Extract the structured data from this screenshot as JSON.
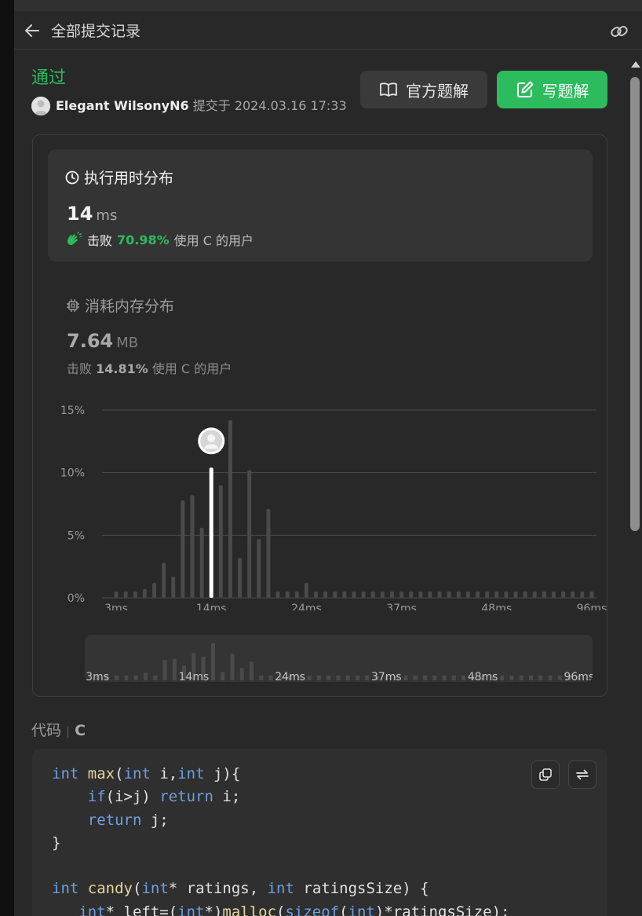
{
  "header": {
    "back_icon": "arrow-left-icon",
    "title": "全部提交记录",
    "link_icon": "link-icon"
  },
  "submission": {
    "status": "通过",
    "user": "Elegant WilsonyN6",
    "submitted_label": "提交于",
    "datetime": "2024.03.16 17:33"
  },
  "buttons": {
    "official_solution": "官方题解",
    "write_solution": "写题解"
  },
  "runtime": {
    "title": "执行用时分布",
    "value": "14",
    "unit": "ms",
    "beat_word": "击败",
    "beat_pct": "70.98%",
    "beat_suffix": "使用 C 的用户"
  },
  "memory": {
    "title": "消耗内存分布",
    "value": "7.64",
    "unit": "MB",
    "beat_word": "击败",
    "beat_pct": "14.81%",
    "beat_suffix": "使用 C 的用户"
  },
  "colors": {
    "accent": "#2cbb5d",
    "bar": "#4a4a4a",
    "highlight_bar": "#ffffff"
  },
  "chart_data": {
    "type": "bar",
    "ylabels": [
      "15%",
      "10%",
      "5%",
      "0%"
    ],
    "yticks": [
      15,
      10,
      5,
      0
    ],
    "ylim": [
      0,
      15
    ],
    "xticks": [
      "3ms",
      "14ms",
      "24ms",
      "37ms",
      "48ms",
      "96ms"
    ],
    "xtick_bar_index": [
      0,
      10,
      20,
      30,
      40,
      50
    ],
    "values": [
      0.5,
      0.5,
      0.5,
      0.7,
      1.2,
      2.8,
      1.7,
      7.8,
      8.2,
      5.6,
      10.4,
      9.0,
      14.2,
      3.2,
      10.2,
      4.7,
      7.1,
      0.5,
      0.5,
      0.5,
      1.2,
      0.5,
      0.5,
      0.5,
      0.5,
      0.5,
      0.5,
      0.5,
      0.5,
      0.5,
      0.5,
      0.5,
      0.5,
      0.5,
      0.5,
      0.5,
      0.5,
      0.5,
      0.5,
      0.5,
      0.5,
      0.5,
      0.5,
      0.5,
      0.5,
      0.5,
      0.5,
      0.5,
      0.5,
      0.5,
      0.5
    ],
    "highlight_index": 10
  },
  "code": {
    "label": "代码",
    "language": "C",
    "copy_icon": "copy-icon",
    "swap_icon": "swap-icon"
  }
}
